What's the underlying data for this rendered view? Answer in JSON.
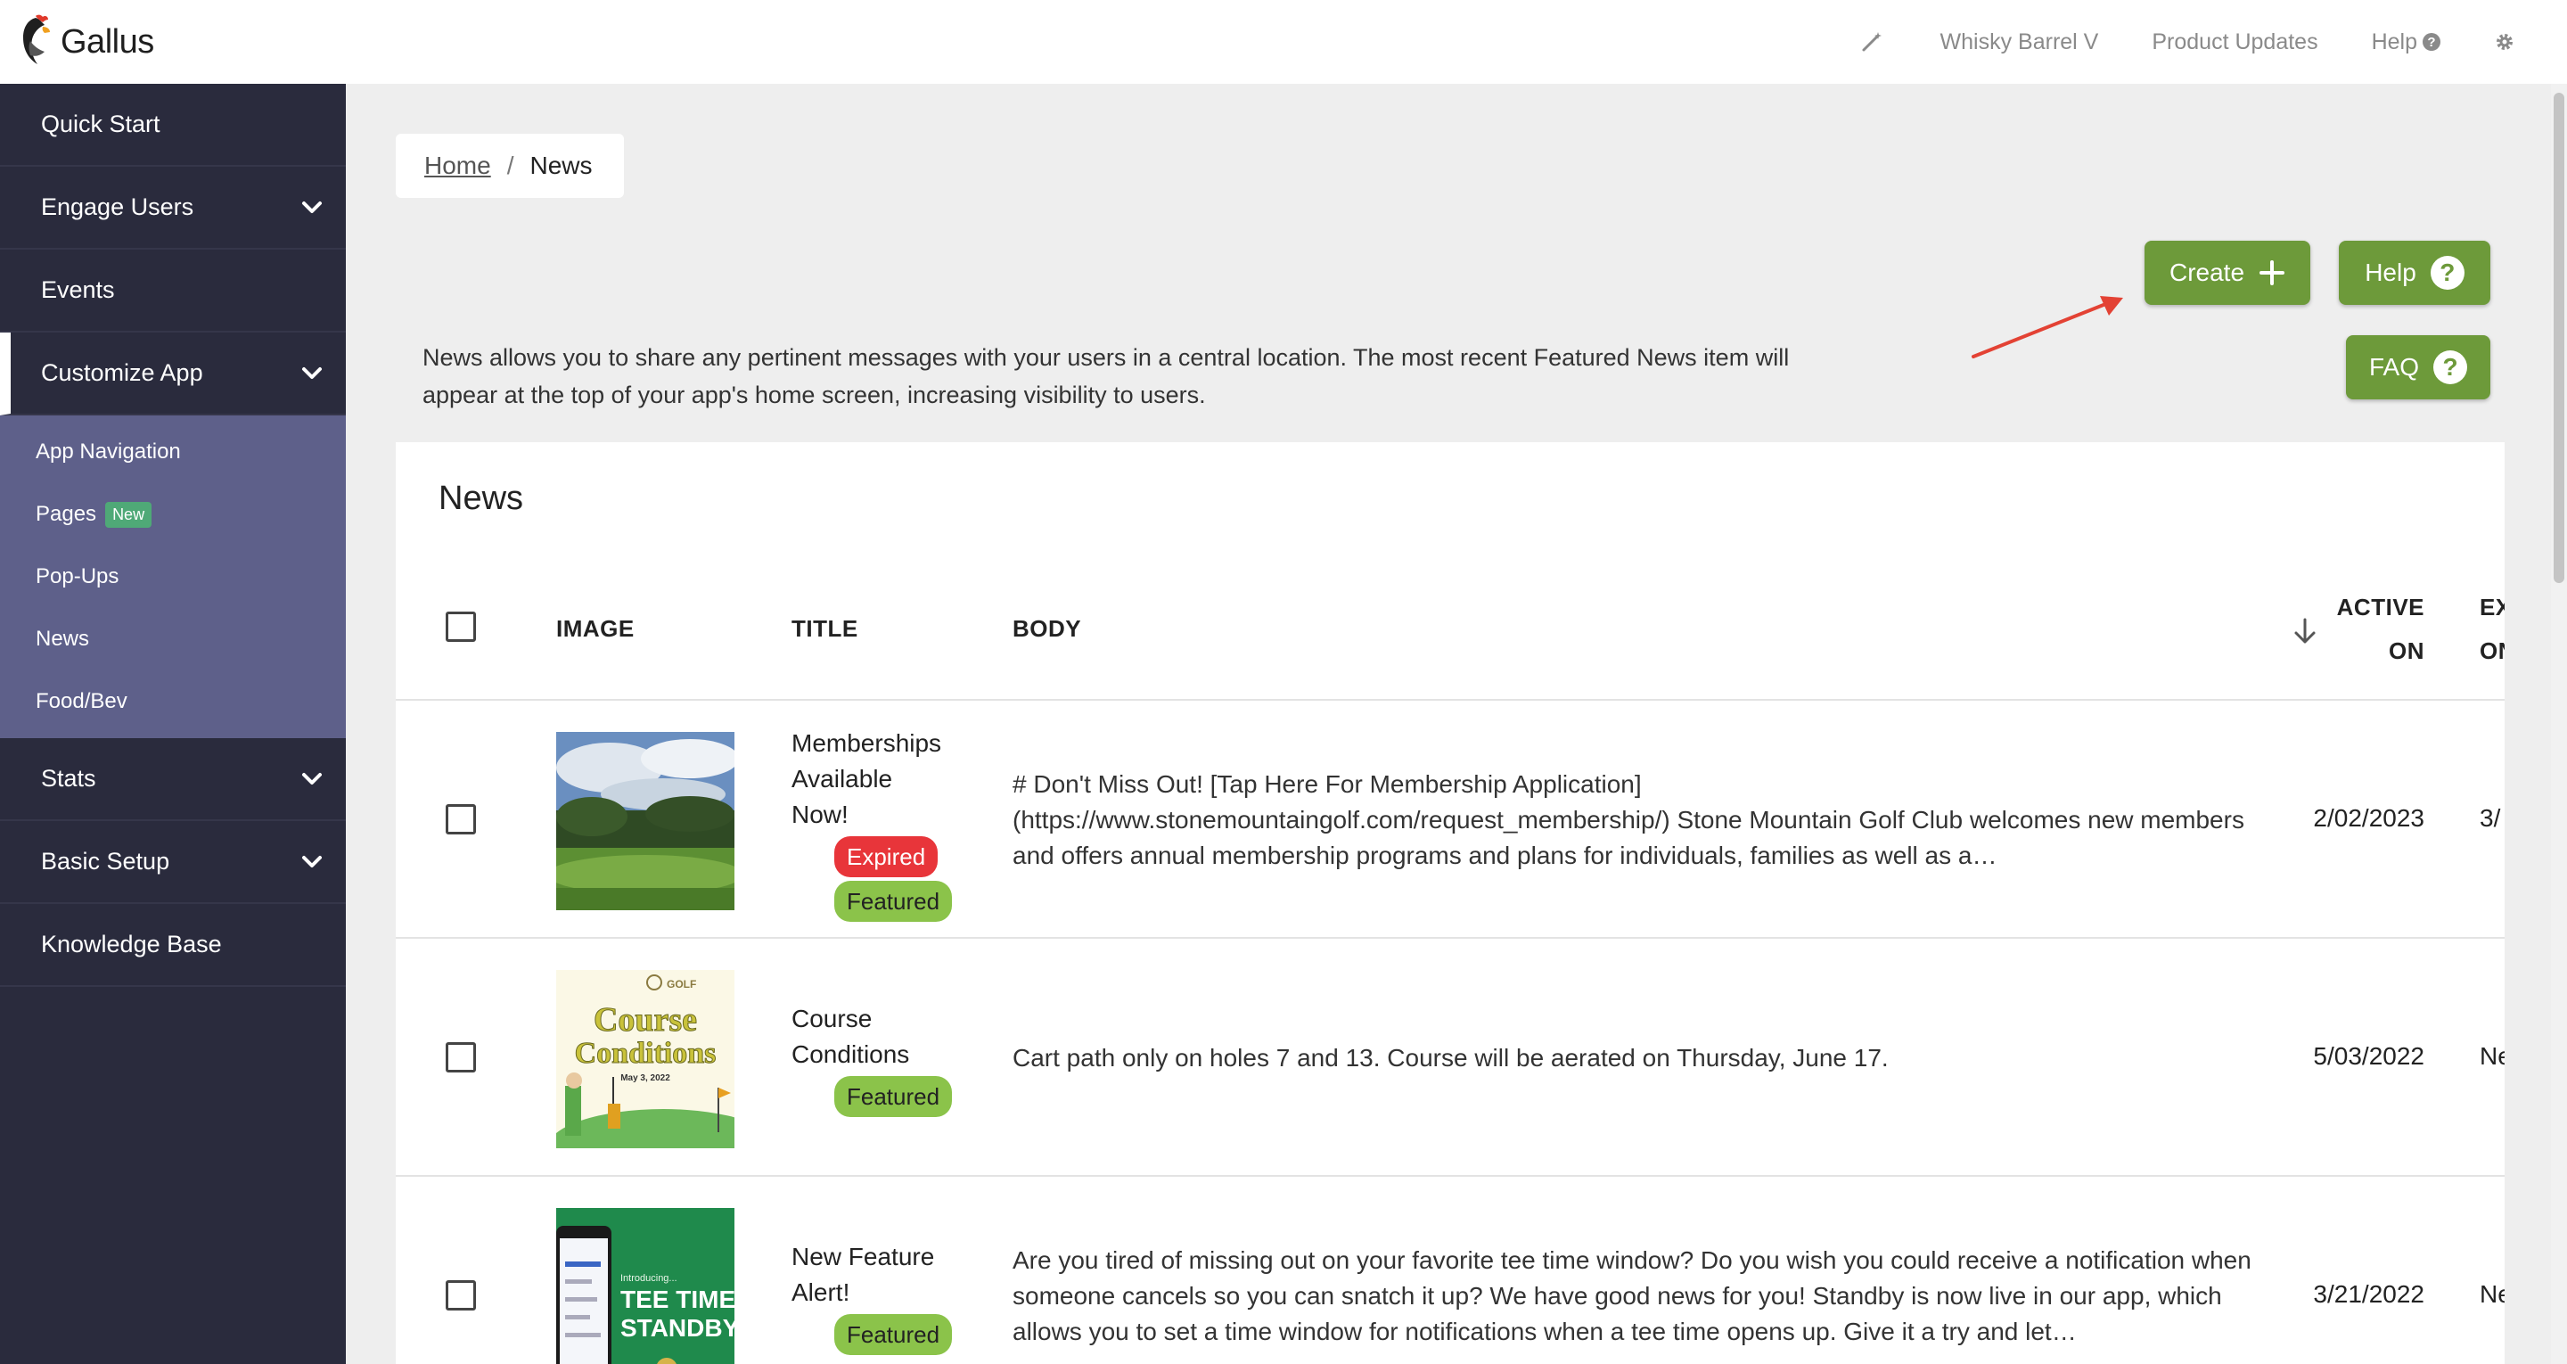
{
  "app": {
    "brand": "Gallus"
  },
  "topbar": {
    "items": [
      "Whisky Barrel V",
      "Product Updates",
      "Help"
    ]
  },
  "sidebar": {
    "items": [
      {
        "label": "Quick Start"
      },
      {
        "label": "Engage Users"
      },
      {
        "label": "Events"
      },
      {
        "label": "Customize App"
      },
      {
        "label": "Stats"
      },
      {
        "label": "Basic Setup"
      },
      {
        "label": "Knowledge Base"
      }
    ],
    "subitems": [
      {
        "label": "App Navigation"
      },
      {
        "label": "Pages",
        "badge": "New"
      },
      {
        "label": "Pop-Ups"
      },
      {
        "label": "News"
      },
      {
        "label": "Food/Bev"
      }
    ]
  },
  "breadcrumb": {
    "home": "Home",
    "separator": "/",
    "current": "News"
  },
  "actions": {
    "create": "Create",
    "help": "Help",
    "faq": "FAQ"
  },
  "intro": "News allows you to share any pertinent messages with your users in a central location. The most recent Featured News item will appear at the top of your app's home screen, increasing visibility to users.",
  "card": {
    "title": "News"
  },
  "table": {
    "columns": {
      "image": "IMAGE",
      "title": "TITLE",
      "body": "BODY",
      "active_on_1": "ACTIVE",
      "active_on_2": "ON",
      "expires_1": "EX",
      "expires_2": "ON"
    },
    "rows": [
      {
        "title_lines": [
          "Memberships",
          "Available",
          "Now!"
        ],
        "tags": [
          "Expired",
          "Featured"
        ],
        "body": "# Don't Miss Out! [Tap Here For Membership Application](https://www.stonemountaingolf.com/request_membership/) Stone Mountain Golf Club welcomes new members and offers annual membership programs and plans for individuals, families as well as a…",
        "active_on": "2/02/2023",
        "expires": "3/"
      },
      {
        "title_lines": [
          "Course",
          "Conditions"
        ],
        "tags": [
          "Featured"
        ],
        "body": "Cart path only on holes 7 and 13. Course will be aerated on Thursday, June 17.",
        "active_on": "5/03/2022",
        "expires": "Ne"
      },
      {
        "title_lines": [
          "New Feature",
          "Alert!"
        ],
        "tags": [
          "Featured"
        ],
        "body": "Are you tired of missing out on your favorite tee time window? Do you wish you could receive a notification when someone cancels so you can snatch it up? We have good news for you! Standby is now live in our app, which allows you to set a time window for notifications when a tee time opens up. Give it a try and let…",
        "active_on": "3/21/2022",
        "expires": "Ne"
      }
    ],
    "thumb_text": {
      "row2_logo": "GOLF",
      "row2_line1": "Course",
      "row2_line2": "Conditions",
      "row2_date": "May 3, 2022",
      "row3_small": "Introducing...",
      "row3_big1": "TEE TIME",
      "row3_big2": "STANDBY"
    }
  },
  "colors": {
    "sidebar": "#2a2b3d",
    "subnav": "#5e608a",
    "accent": "#6d9a3a",
    "expired": "#e8353a",
    "featured": "#8bc34a"
  }
}
